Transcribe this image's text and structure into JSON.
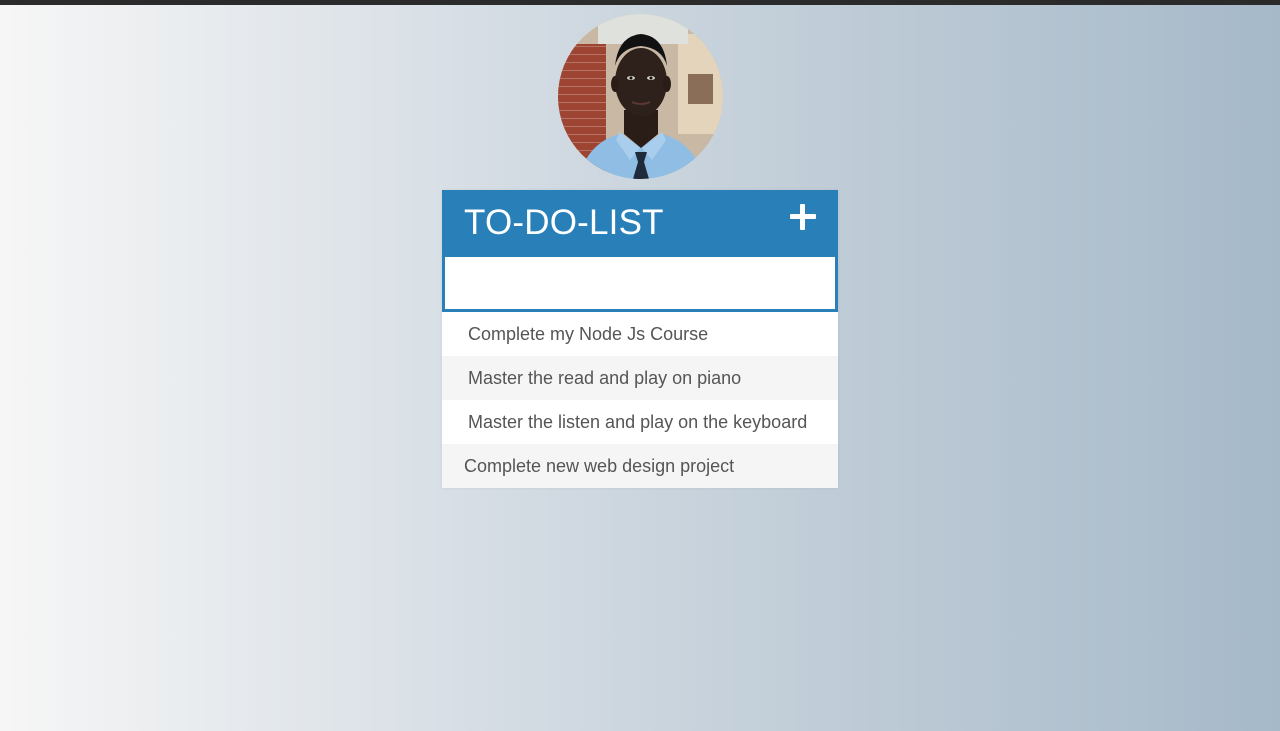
{
  "app": {
    "title": "TO-DO-LIST"
  },
  "header": {
    "add_icon": "plus-icon"
  },
  "new_todo": {
    "value": "",
    "placeholder": ""
  },
  "todos": [
    {
      "text": "Complete my Node Js Course"
    },
    {
      "text": "Master the read and play on piano"
    },
    {
      "text": "Master the listen and play on the keyboard"
    },
    {
      "text": "Complete new web design project"
    }
  ],
  "colors": {
    "accent": "#2980b9",
    "text": "#555555",
    "row_alt": "#f5f5f5",
    "top_bar": "#2b2b2b"
  }
}
